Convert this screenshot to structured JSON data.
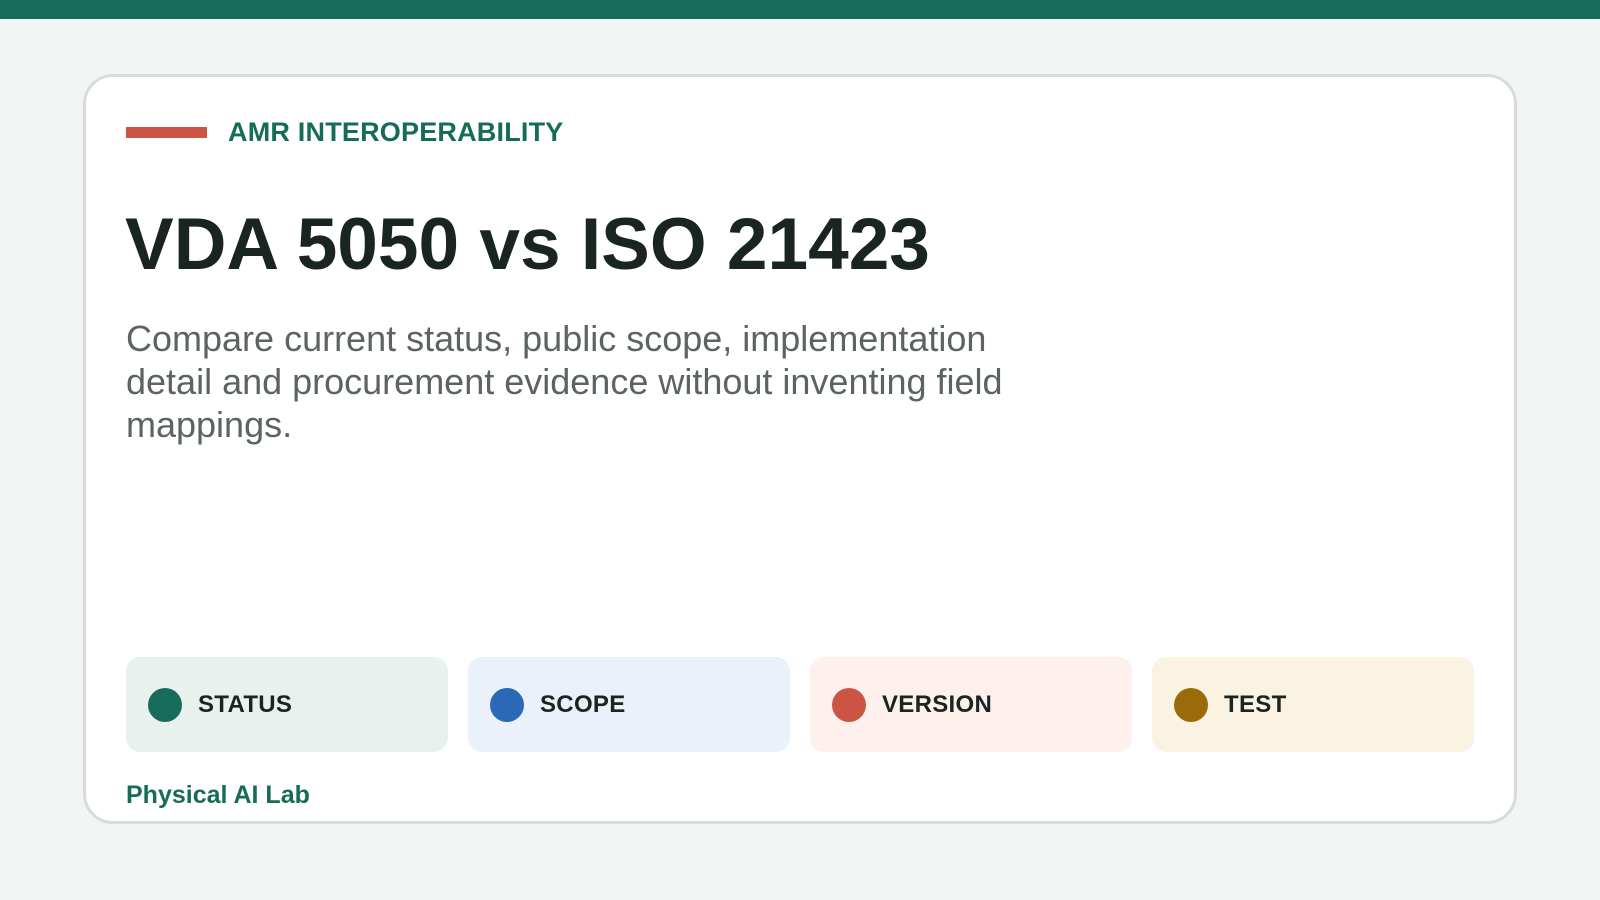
{
  "header": {
    "kicker": "AMR INTEROPERABILITY",
    "title": "VDA 5050 vs ISO 21423",
    "subtitle": "Compare current status, public scope, implementation detail and procurement evidence without inventing field mappings."
  },
  "pills": [
    {
      "label": "STATUS",
      "dot_color": "#176b59",
      "bg_color": "#e8f1ee"
    },
    {
      "label": "SCOPE",
      "dot_color": "#2b68b6",
      "bg_color": "#eaf1fb"
    },
    {
      "label": "VERSION",
      "dot_color": "#cc5444",
      "bg_color": "#fdf0ed"
    },
    {
      "label": "TEST",
      "dot_color": "#9a6a0b",
      "bg_color": "#fbf3e2"
    }
  ],
  "footer": {
    "brand": "Physical AI Lab"
  },
  "colors": {
    "accent": "#176b59",
    "kicker_bar": "#cc5444"
  }
}
